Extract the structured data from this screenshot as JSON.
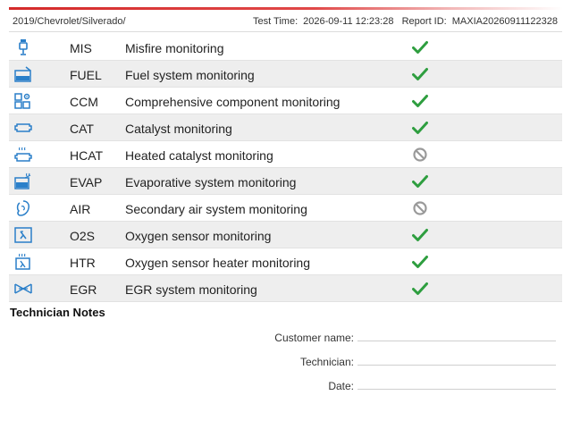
{
  "header": {
    "vehicle": "2019/Chevrolet/Silverado/",
    "test_time_label": "Test Time:",
    "test_time_value": "2026-09-11 12:23:28",
    "report_id_label": "Report ID:",
    "report_id_value": "MAXIA20260911122328"
  },
  "colors": {
    "accent_red": "#d42a2a",
    "icon_blue": "#2a7fc9",
    "pass_green": "#2e9e3f",
    "na_gray": "#9a9a9a",
    "row_alt": "#eeeeee"
  },
  "monitors": [
    {
      "icon": "misfire-icon",
      "code": "MIS",
      "description": "Misfire monitoring",
      "status": "pass"
    },
    {
      "icon": "fuel-system-icon",
      "code": "FUEL",
      "description": "Fuel system monitoring",
      "status": "pass"
    },
    {
      "icon": "component-icon",
      "code": "CCM",
      "description": "Comprehensive component monitoring",
      "status": "pass"
    },
    {
      "icon": "catalyst-icon",
      "code": "CAT",
      "description": "Catalyst monitoring",
      "status": "pass"
    },
    {
      "icon": "heated-catalyst-icon",
      "code": "HCAT",
      "description": "Heated catalyst monitoring",
      "status": "not-supported"
    },
    {
      "icon": "evap-icon",
      "code": "EVAP",
      "description": "Evaporative system monitoring",
      "status": "pass"
    },
    {
      "icon": "secondary-air-icon",
      "code": "AIR",
      "description": "Secondary air system monitoring",
      "status": "not-supported"
    },
    {
      "icon": "oxygen-sensor-icon",
      "code": "O2S",
      "description": "Oxygen sensor monitoring",
      "status": "pass"
    },
    {
      "icon": "o2-heater-icon",
      "code": "HTR",
      "description": "Oxygen sensor heater monitoring",
      "status": "pass"
    },
    {
      "icon": "egr-icon",
      "code": "EGR",
      "description": "EGR system monitoring",
      "status": "pass"
    }
  ],
  "notes": {
    "title": "Technician Notes",
    "customer_label": "Customer name:",
    "technician_label": "Technician:",
    "date_label": "Date:"
  }
}
